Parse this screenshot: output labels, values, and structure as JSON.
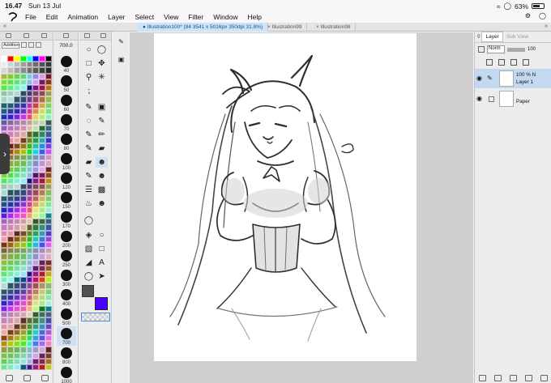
{
  "status": {
    "time": "16.47",
    "date": "Sun 13 Jul",
    "battery": "63%"
  },
  "menu": [
    "File",
    "Edit",
    "Animation",
    "Layer",
    "Select",
    "View",
    "Filter",
    "Window",
    "Help"
  ],
  "tabs": [
    {
      "label": "Illustration100* (84 3541 x 5016px 350dpi 31.8%)",
      "active": true
    },
    {
      "label": "Illustration99",
      "active": false
    },
    {
      "label": "Illustration98",
      "active": false
    }
  ],
  "palette": {
    "set_name": "Addition"
  },
  "brush": {
    "current": "700.0",
    "sizes": [
      "40",
      "50",
      "60",
      "70",
      "80",
      "100",
      "120",
      "150",
      "170",
      "200",
      "250",
      "300",
      "400",
      "500",
      "700",
      "800",
      "1000"
    ],
    "active_size": "700"
  },
  "colors": {
    "main": "#505050",
    "sub": "#4a00ff",
    "accent": "#3a7fd5"
  },
  "layer_panel": {
    "tabs": [
      "Layer",
      "Sub View"
    ],
    "blend_mode": "Norm",
    "opacity": "100",
    "layers": [
      {
        "opacity": "100 %",
        "mode": "N",
        "name": "Layer 1",
        "active": true
      },
      {
        "opacity": "",
        "mode": "",
        "name": "Paper",
        "active": false
      }
    ]
  }
}
